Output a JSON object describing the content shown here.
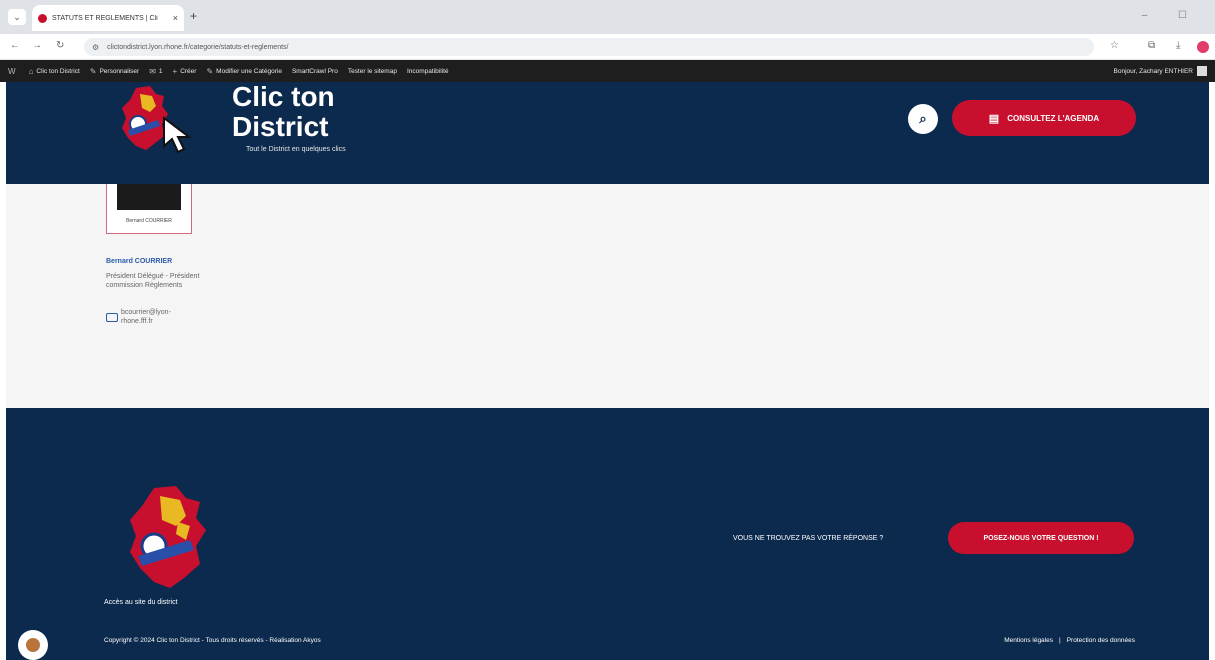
{
  "browser": {
    "tab_title": "STATUTS ET RÈGLEMENTS | Cli",
    "tab_close": "×",
    "new_tab": "+",
    "url": "clictondistrict.lyon.rhone.fr/categorie/statuts-et-reglements/",
    "window_controls": "– ☐"
  },
  "admin_bar": {
    "items": [
      {
        "icon": "W",
        "label": ""
      },
      {
        "icon": "⌂",
        "label": "Clic ton District"
      },
      {
        "icon": "✎",
        "label": "Personnaliser"
      },
      {
        "icon": "✉",
        "label": "1"
      },
      {
        "icon": "+",
        "label": "Créer"
      },
      {
        "icon": "✎",
        "label": "Modifier une Catégorie"
      },
      {
        "icon": "",
        "label": "SmartCrawl Pro"
      },
      {
        "icon": "",
        "label": "Tester le sitemap"
      },
      {
        "icon": "",
        "label": "Incompatibilité"
      }
    ],
    "user": "Bonjour, Zachary ENTHIER"
  },
  "header": {
    "title": "Clic ton District",
    "tagline": "Tout le District en quelques clics",
    "search_icon": "⌕",
    "agenda_label": "CONSULTEZ L'AGENDA",
    "agenda_icon": "▤"
  },
  "person": {
    "photo_caption": "Bernard COURRIER",
    "name": "Bernard COURRIER",
    "role": "Président Délégué - Président commission Règlements",
    "email": "bcourrier@lyon-rhone.fff.fr"
  },
  "footer": {
    "site_link": "Accès au site du district",
    "question_text": "VOUS NE TROUVEZ PAS VOTRE RÉPONSE ?",
    "question_button": "POSEZ-NOUS VOTRE QUESTION !",
    "copyright": "Copyright © 2024 Clic ton District - Tous droits réservés - Réalisation Akyos",
    "legal_1": "Mentions légales",
    "legal_sep": "|",
    "legal_2": "Protection des données"
  },
  "colors": {
    "navy": "#0c2a4d",
    "red": "#c8102e",
    "admin_bar": "#1e1e1e"
  }
}
